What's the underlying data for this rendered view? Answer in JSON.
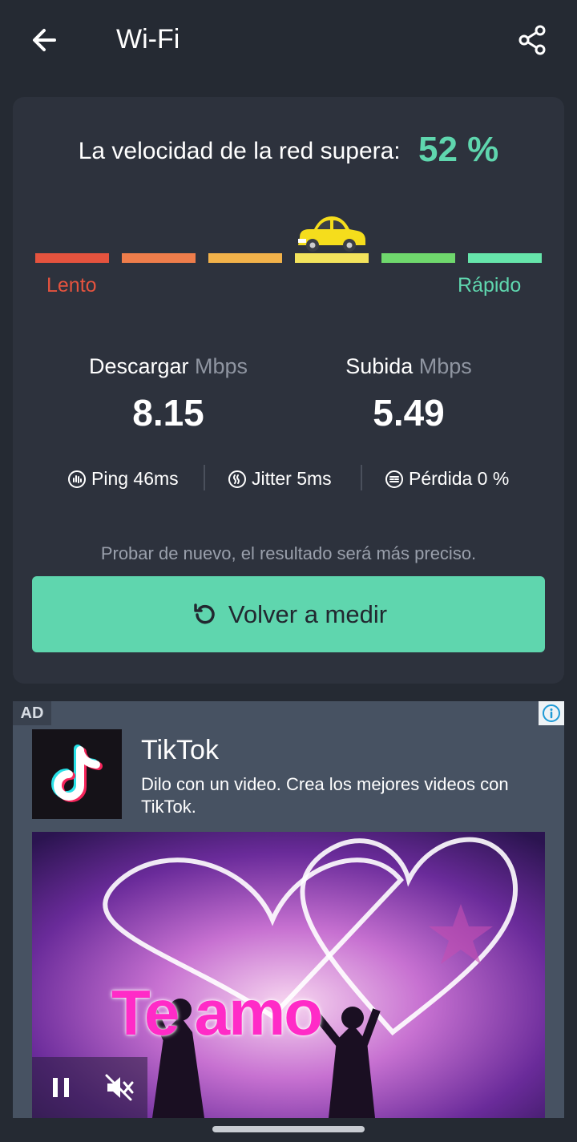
{
  "appbar": {
    "title": "Wi-Fi"
  },
  "result": {
    "headline": "La velocidad de la red supera:",
    "percent": "52 %",
    "percent_value": 0.52,
    "scale_slow": "Lento",
    "scale_fast": "Rápido",
    "scale_colors": [
      "#e5533e",
      "#ee7d4b",
      "#f2b24a",
      "#f3e35c",
      "#6fd86d",
      "#66e5ab"
    ],
    "active_segment": 4
  },
  "download": {
    "label": "Descargar",
    "unit": "Mbps",
    "value": "8.15"
  },
  "upload": {
    "label": "Subida",
    "unit": "Mbps",
    "value": "5.49"
  },
  "metrics": {
    "ping": "Ping 46ms",
    "jitter": "Jitter 5ms",
    "loss": "Pérdida 0 %"
  },
  "hint": "Probar de nuevo, el resultado será más preciso.",
  "retest_label": "Volver a medir",
  "ad": {
    "tag": "AD",
    "app_name": "TikTok",
    "description": "Dilo con un video. Crea los mejores videos con TikTok.",
    "media_text": "Te amo"
  },
  "colors": {
    "accent": "#5fd6ae",
    "background": "#252a33",
    "card": "#2d323d"
  }
}
